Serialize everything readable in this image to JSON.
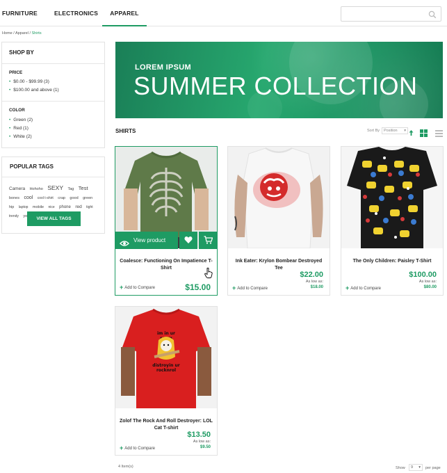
{
  "nav": {
    "items": [
      {
        "label": "FURNITURE",
        "active": false
      },
      {
        "label": "ELECTRONICS",
        "active": false
      },
      {
        "label": "APPAREL",
        "active": true
      }
    ],
    "search": {
      "placeholder": "",
      "value": ""
    }
  },
  "breadcrumb": {
    "home": "Home",
    "sep1": " / ",
    "apparel": "Apparel",
    "sep2": " / ",
    "current": "Shirts"
  },
  "sidebar": {
    "shop_by": {
      "title": "SHOP BY",
      "price_title": "PRICE",
      "price_items": [
        "$0.00 - $99.99 (3)",
        "$100.00 and above (1)"
      ],
      "color_title": "COLOR",
      "color_items": [
        "Green (2)",
        "Red (1)",
        "White (2)"
      ]
    },
    "popular_tags": {
      "title": "POPULAR TAGS",
      "tags": [
        "Camera",
        "Hohoho",
        "SEXY",
        "Tag",
        "Test",
        "bones",
        "cool",
        "cool t-shirt",
        "crap",
        "good",
        "green",
        "hip",
        "laptop",
        "mobile",
        "nice",
        "phone",
        "red",
        "tight",
        "trendy",
        "young"
      ],
      "button": "VIEW ALL TAGS"
    }
  },
  "banner": {
    "kicker": "LOREM IPSUM",
    "headline": "SUMMER COLLECTION"
  },
  "listing": {
    "title": "SHIRTS",
    "sort_label": "Sort By",
    "sort_value": "Position",
    "items_count": "4 Item(s)",
    "show_label": "Show",
    "show_value": "9",
    "per_page_label": "per page"
  },
  "products": [
    {
      "name": "Coalesce: Functioning On Impatience T-Shirt",
      "price": "$15.00",
      "compare": "Add to Compare",
      "view": "View product"
    },
    {
      "name": "Ink Eater: Krylon Bombear Destroyed Tee",
      "price": "$22.00",
      "as_low_as": "As low as:",
      "low_price": "$18.00",
      "compare": "Add to Compare"
    },
    {
      "name": "The Only Children: Paisley T-Shirt",
      "price": "$100.00",
      "as_low_as": "As low as:",
      "low_price": "$80.00",
      "compare": "Add to Compare"
    },
    {
      "name": "Zolof The Rock And Roll Destroyer: LOL Cat T-shirt",
      "price": "$13.50",
      "as_low_as": "As low as:",
      "low_price": "$9.50",
      "compare": "Add to Compare"
    }
  ],
  "colors": {
    "accent": "#1e9b63"
  },
  "icons": [
    "search-icon",
    "eye-icon",
    "heart-icon",
    "cart-icon",
    "grid-view-icon",
    "list-view-icon",
    "sort-arrow-icon",
    "hand-cursor-icon"
  ]
}
